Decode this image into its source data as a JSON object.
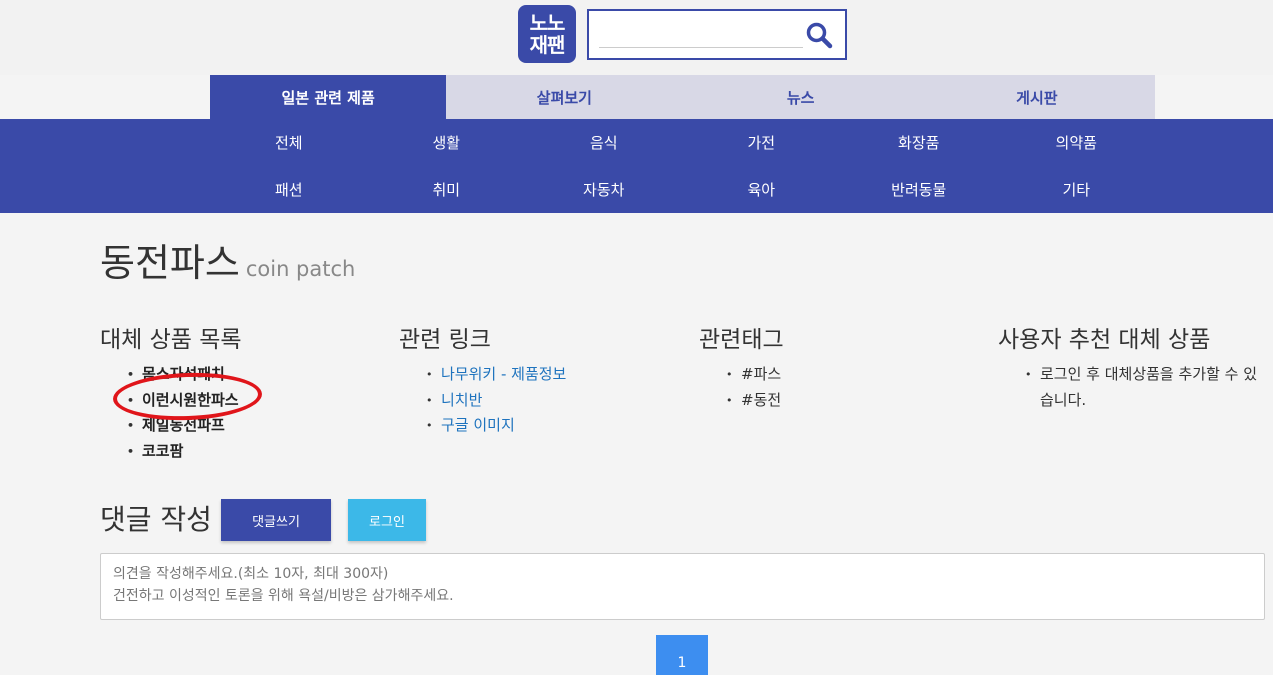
{
  "header": {
    "logo_line1": "노노",
    "logo_line2": "재팬",
    "search_placeholder": ""
  },
  "main_tabs": [
    {
      "label": "일본 관련 제품",
      "active": true
    },
    {
      "label": "살펴보기",
      "active": false
    },
    {
      "label": "뉴스",
      "active": false
    },
    {
      "label": "게시판",
      "active": false
    }
  ],
  "categories": [
    "전체",
    "생활",
    "음식",
    "가전",
    "화장품",
    "의약품",
    "패션",
    "취미",
    "자동차",
    "육아",
    "반려동물",
    "기타"
  ],
  "product": {
    "name": "동전파스",
    "subtitle": "coin patch"
  },
  "alternatives": {
    "title": "대체 상품 목록",
    "items": [
      "몸스자석패치",
      "이런시원한파스",
      "제일동전파프",
      "코코팜"
    ]
  },
  "links": {
    "title": "관련 링크",
    "items": [
      "나무위키 - 제품정보",
      "니치반",
      "구글 이미지"
    ]
  },
  "tags": {
    "title": "관련태그",
    "items": [
      "#파스",
      "#동전"
    ]
  },
  "user_recommend": {
    "title": "사용자 추천 대체 상품",
    "items": [
      "로그인 후 대체상품을 추가할 수 있습니다."
    ]
  },
  "comments": {
    "title": "댓글 작성",
    "write_label": "댓글쓰기",
    "login_label": "로그인",
    "placeholder_line1": "의견을 작성해주세요.(최소 10자, 최대 300자)",
    "placeholder_line2": "건전하고 이성적인 토론을 위해 욕설/비방은 삼가해주세요."
  },
  "pagination": {
    "current": "1"
  },
  "colors": {
    "brand": "#3a4aa8",
    "tab_inactive": "#d8d8e6",
    "link": "#1e73be",
    "login_button": "#3cb8e8",
    "page_button": "#3d8ef0",
    "annotation": "#e0151a"
  }
}
